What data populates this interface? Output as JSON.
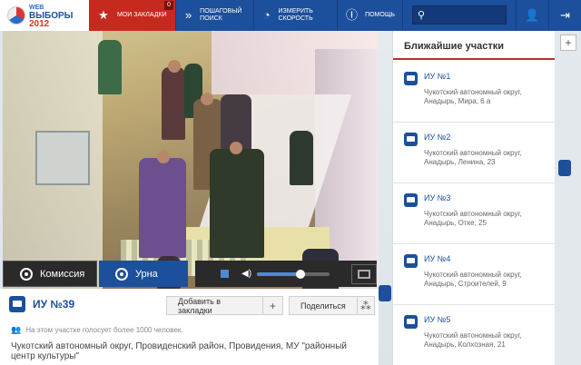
{
  "header": {
    "logo": {
      "line1": "WEB",
      "line2": "ВЫБОРЫ",
      "line3": "2012"
    },
    "nav": [
      {
        "label": "Мои закладки",
        "icon": "star-icon",
        "badge": "0"
      },
      {
        "label": "Пошаговый поиск",
        "icon": "step-search-icon"
      },
      {
        "label": "Измерить скорость",
        "icon": "speedometer-icon"
      },
      {
        "label": "Помощь",
        "icon": "help-icon"
      }
    ],
    "search": {
      "placeholder": "",
      "value": ""
    },
    "user_icon": "user-icon",
    "logout_icon": "logout-icon"
  },
  "video": {
    "cameras": [
      {
        "label": "Комиссия",
        "active": false
      },
      {
        "label": "Урна",
        "active": true
      }
    ],
    "volume": 0.6
  },
  "station": {
    "title": "ИУ №39",
    "bookmark_button": "Добавить в закладки",
    "share_button": "Поделиться",
    "note": "На этом участке голосует более 1000 человек.",
    "address": "Чукотский автономный округ, Провиденский район, Провидения, МУ \"районный центр культуры\""
  },
  "nearby": {
    "title": "Ближайшие участки",
    "items": [
      {
        "name": "ИУ №1",
        "address": "Чукотский автономный округ, Анадырь, Мира, 6 а"
      },
      {
        "name": "ИУ №2",
        "address": "Чукотский автономный округ, Анадырь, Ленина, 23"
      },
      {
        "name": "ИУ №3",
        "address": "Чукотский автономный округ, Анадырь, Отке, 25"
      },
      {
        "name": "ИУ №4",
        "address": "Чукотский автономный округ, Анадырь, Строителей, 9"
      },
      {
        "name": "ИУ №5",
        "address": "Чукотский автономный округ, Анадырь, Колхозная, 21"
      }
    ]
  },
  "colors": {
    "brand_blue": "#1c4f9c",
    "accent_red": "#c62a1f"
  }
}
